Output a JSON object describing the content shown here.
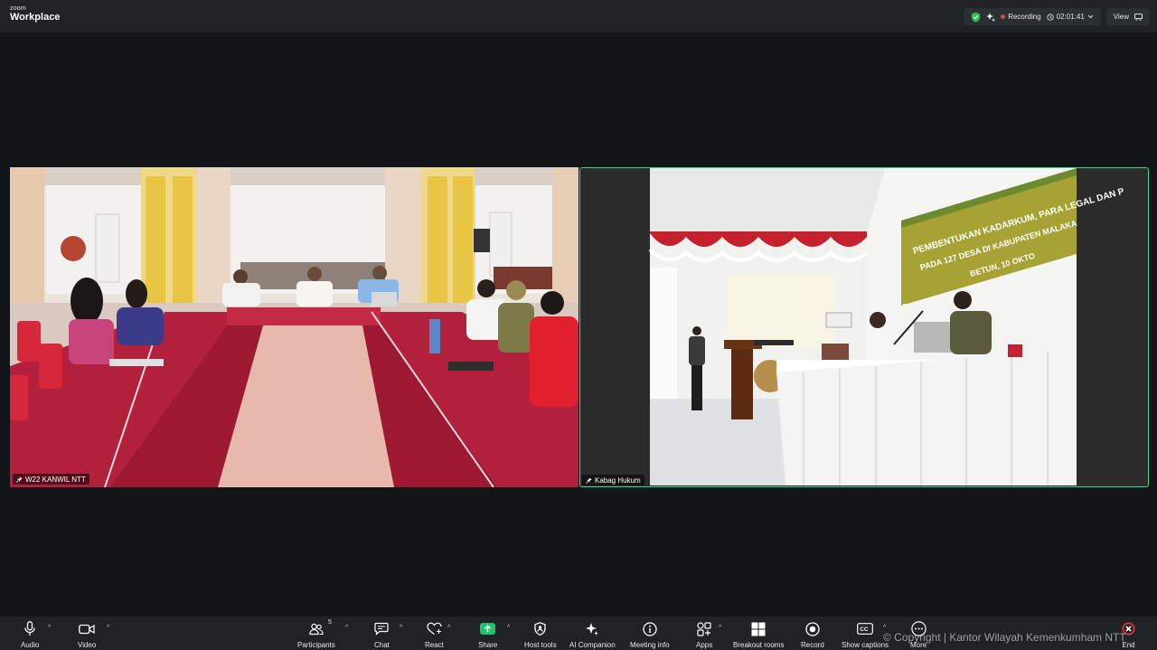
{
  "app": {
    "brand_top": "zoom",
    "brand_bottom": "Workplace"
  },
  "header": {
    "recording_label": "Recording",
    "elapsed_time": "02:01:41",
    "view_label": "View",
    "colors": {
      "shield": "#2fbf4a",
      "recording_dot": "#e2453c"
    }
  },
  "participants": [
    {
      "name": "W22 KANWIL NTT"
    },
    {
      "name": "Kabag Hukum",
      "active_speaker": true,
      "highlight_color": "#3fd48e"
    }
  ],
  "banner_text": {
    "line1": "PEMBENTUKAN KADARKUM, PARA LEGAL DAN P",
    "line2": "PADA 127 DESA DI KABUPATEN MALAKA",
    "line3": "BETUN, 10 OKTO"
  },
  "toolbar": {
    "audio": "Audio",
    "video": "Video",
    "participants": "Participants",
    "participants_count": "5",
    "chat": "Chat",
    "react": "React",
    "share": "Share",
    "host_tools": "Host tools",
    "ai_companion": "AI Companion",
    "meeting_info": "Meeting info",
    "apps": "Apps",
    "breakout_rooms": "Breakout rooms",
    "record": "Record",
    "show_captions": "Show captions",
    "more": "More",
    "end": "End",
    "colors": {
      "share": "#23c16b",
      "end": "#e0343a"
    }
  },
  "watermark": "© Copyright | Kantor Wilayah Kemenkumham NTT"
}
